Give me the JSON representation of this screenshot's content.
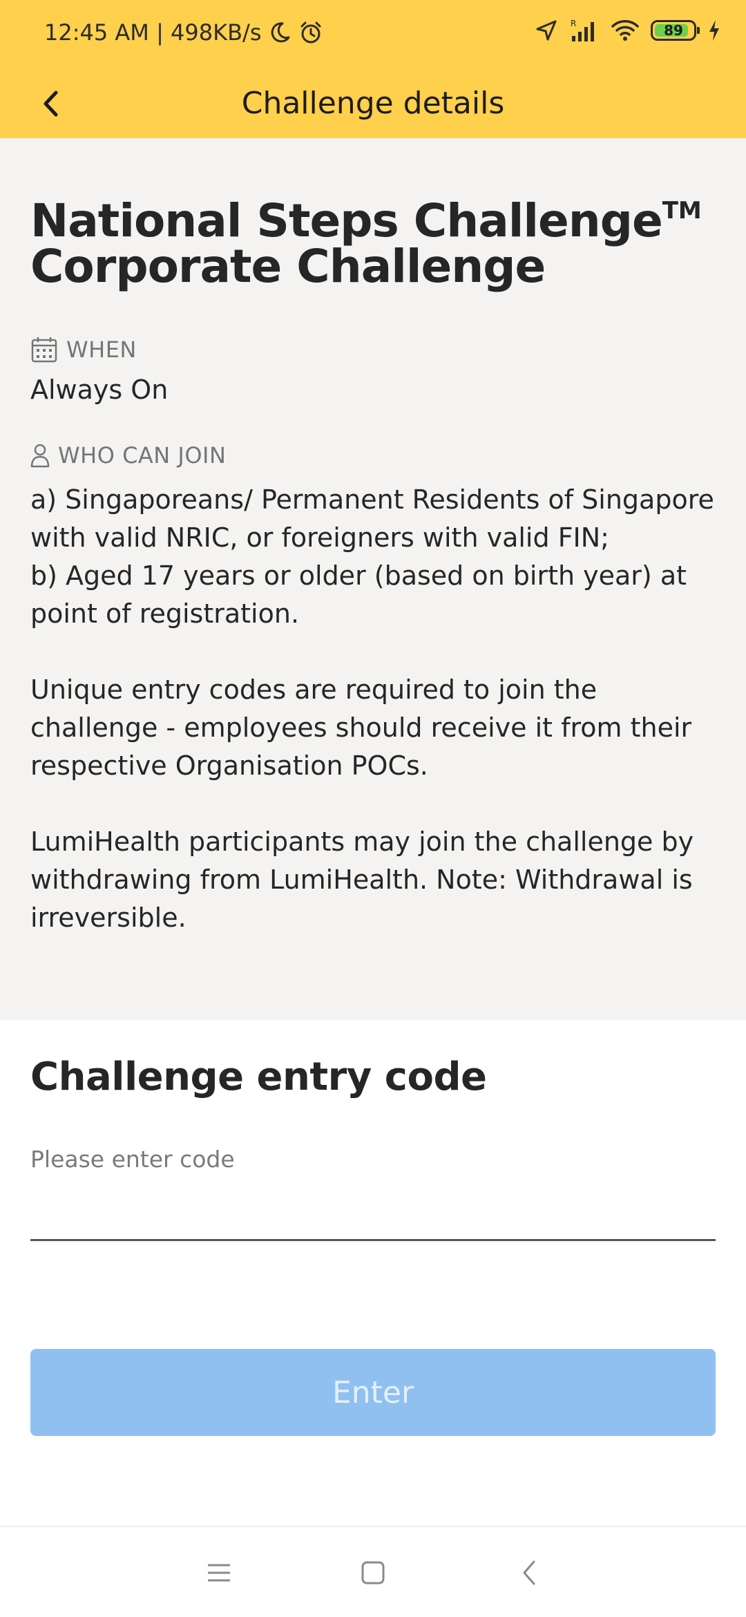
{
  "status_bar": {
    "time_speed": "12:45 AM | 498KB/s",
    "battery_level": "89",
    "battery_fraction": 0.89,
    "battery_color": "#6cd04a",
    "icons": [
      "moon-icon",
      "alarm-icon",
      "location-arrow-icon",
      "signal-icon",
      "wifi-icon",
      "battery-icon",
      "charging-icon"
    ]
  },
  "app_bar": {
    "title": "Challenge details",
    "background": "#ffd04b",
    "back_icon": "chevron-left-icon"
  },
  "challenge": {
    "title_line1": "National Steps Challenge",
    "title_mark": "TM",
    "title_line2": "Corporate Challenge",
    "when_label": "WHEN",
    "when_value": "Always On",
    "who_label": "WHO CAN JOIN",
    "who_line_a": "a) Singaporeans/ Permanent Residents of Singapore with valid NRIC, or foreigners with valid FIN;",
    "who_line_b": "b) Aged 17 years or older (based on birth year) at point of registration.",
    "entry_code_note": "Unique entry codes are required to join the challenge - employees should receive it from their respective Organisation POCs.",
    "lumihealth_note": "LumiHealth participants may join the challenge by withdrawing from LumiHealth. Note: Withdrawal is irreversible."
  },
  "entry_code": {
    "heading": "Challenge entry code",
    "label": "Please enter code",
    "value": "",
    "button_label": "Enter",
    "button_color": "#90c0ef"
  },
  "nav_bar": {
    "icons": [
      "menu-icon",
      "home-square-icon",
      "back-chevron-icon"
    ]
  }
}
